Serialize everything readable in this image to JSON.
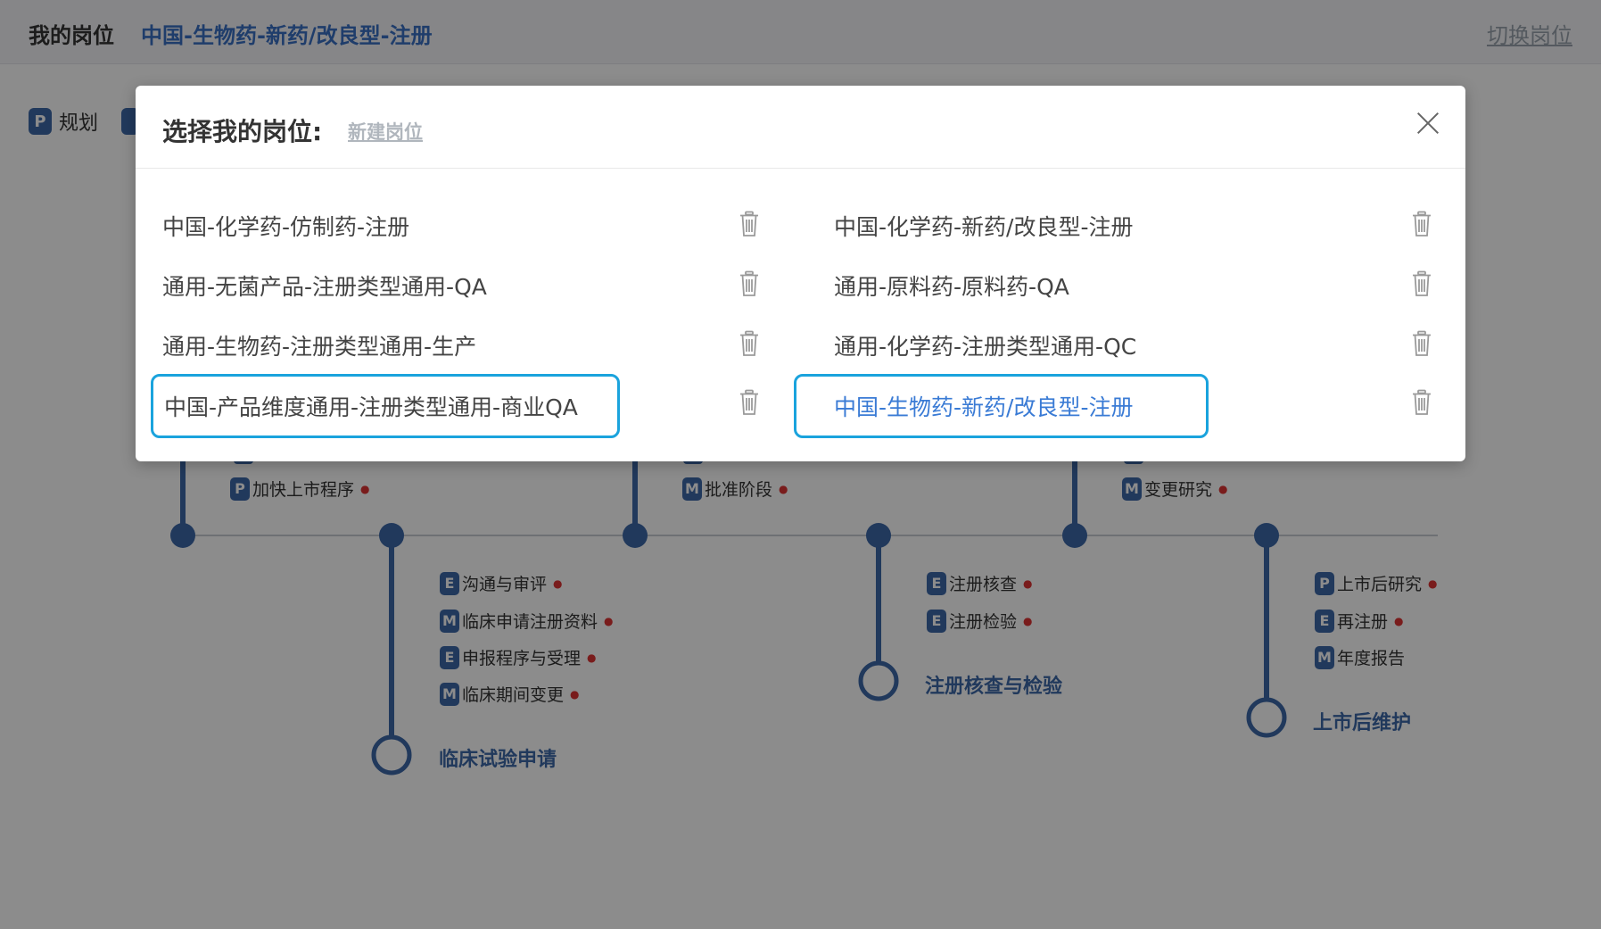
{
  "topbar": {
    "my_label": "我的岗位",
    "current_role": "中国-生物药-新药/改良型-注册",
    "switch_label": "切换岗位"
  },
  "legend": {
    "badge": "P",
    "text": "规划"
  },
  "timeline": {
    "upper_items": [
      {
        "badge": "P",
        "text": "加快上市程序"
      },
      {
        "badge": "M",
        "text": "批准阶段"
      },
      {
        "badge": "M",
        "text": "变更研究"
      }
    ],
    "stages": [
      {
        "title": "临床试验申请",
        "items": [
          {
            "badge": "E",
            "text": "沟通与审评"
          },
          {
            "badge": "M",
            "text": "临床申请注册资料"
          },
          {
            "badge": "E",
            "text": "申报程序与受理"
          },
          {
            "badge": "M",
            "text": "临床期间变更"
          }
        ]
      },
      {
        "title": "注册核查与检验",
        "items": [
          {
            "badge": "E",
            "text": "注册核查"
          },
          {
            "badge": "E",
            "text": "注册检验"
          }
        ]
      },
      {
        "title": "上市后维护",
        "items": [
          {
            "badge": "P",
            "text": "上市后研究"
          },
          {
            "badge": "E",
            "text": "再注册"
          },
          {
            "badge": "M",
            "text": "年度报告"
          }
        ]
      }
    ]
  },
  "modal": {
    "title": "选择我的岗位:",
    "new_role_label": "新建岗位",
    "close_icon": "close-icon",
    "roles_left": [
      "中国-化学药-仿制药-注册",
      "通用-无菌产品-注册类型通用-QA",
      "通用-生物药-注册类型通用-生产",
      "中国-产品维度通用-注册类型通用-商业QA"
    ],
    "roles_right": [
      "中国-化学药-新药/改良型-注册",
      "通用-原料药-原料药-QA",
      "通用-化学药-注册类型通用-QC",
      "中国-生物药-新药/改良型-注册"
    ],
    "active_role": "中国-生物药-新药/改良型-注册",
    "highlight_color": "#1aa3dd",
    "accent_color": "#3a7bd5"
  }
}
